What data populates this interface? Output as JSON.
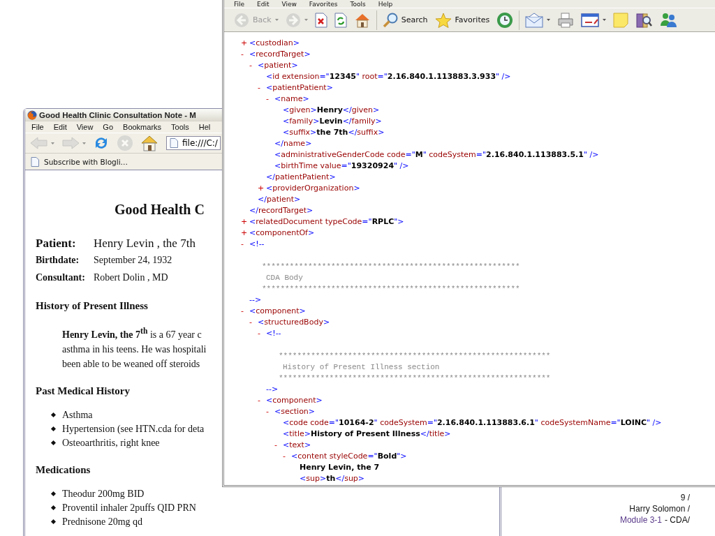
{
  "firefox_window": {
    "title": "Good Health Clinic Consultation Note - M",
    "menu": [
      "File",
      "Edit",
      "View",
      "Go",
      "Bookmarks",
      "Tools",
      "Hel"
    ],
    "toolbar": [
      {
        "kind": "back",
        "disabled": true,
        "dropdown": true
      },
      {
        "kind": "forward",
        "disabled": true,
        "dropdown": true
      },
      {
        "kind": "reload",
        "disabled": false,
        "dropdown": false
      },
      {
        "kind": "stop",
        "disabled": true,
        "dropdown": false
      },
      {
        "kind": "home",
        "disabled": false,
        "dropdown": false
      }
    ],
    "address": "file:///C:/",
    "bookmarks": [
      "Subscribe with Blogli…"
    ],
    "document": {
      "title": "Good Health C",
      "header": [
        {
          "label": "Patient:",
          "value": "Henry Levin , the 7th"
        },
        {
          "label": "Birthdate:",
          "value": "September 24, 1932"
        },
        {
          "label": "Consultant:",
          "value": "Robert Dolin , MD"
        }
      ],
      "sections": [
        {
          "kind": "paragraph",
          "heading": "History of Present Illness",
          "lines": [
            "**Henry Levin, the 7$^{th}$** is a 67 year c",
            "asthma in his teens. He was hospitali",
            "been able to be weaned off steroids"
          ]
        },
        {
          "kind": "list",
          "heading": "Past Medical History",
          "items": [
            "Asthma",
            "Hypertension (see HTN.cda for deta",
            "Osteoarthritis, right knee"
          ]
        },
        {
          "kind": "list",
          "heading": "Medications",
          "items": [
            "Theodur 200mg BID",
            "Proventil inhaler 2puffs QID PRN",
            "Prednisone 20mg qd"
          ]
        }
      ]
    }
  },
  "ie_window": {
    "menu": [
      "File",
      "Edit",
      "View",
      "Favorites",
      "Tools",
      "Help"
    ],
    "toolbar": [
      [
        {
          "kind": "back",
          "label": "Back",
          "disabled": true,
          "dropdown": true
        },
        {
          "kind": "forward",
          "disabled": true,
          "dropdown": true
        },
        {
          "kind": "stop",
          "disabled": false,
          "dropdown": false
        },
        {
          "kind": "refresh",
          "disabled": false,
          "dropdown": false
        },
        {
          "kind": "home",
          "disabled": false,
          "dropdown": false
        }
      ],
      [
        {
          "kind": "search",
          "label": "Search",
          "disabled": false,
          "dropdown": false
        },
        {
          "kind": "favorites",
          "label": "Favorites",
          "disabled": false,
          "dropdown": false
        },
        {
          "kind": "history",
          "disabled": false,
          "dropdown": false
        }
      ],
      [
        {
          "kind": "mail",
          "disabled": false,
          "dropdown": true
        },
        {
          "kind": "print",
          "disabled": false,
          "dropdown": false
        },
        {
          "kind": "edit",
          "disabled": false,
          "dropdown": true
        },
        {
          "kind": "note",
          "disabled": false,
          "dropdown": false
        },
        {
          "kind": "research",
          "disabled": false,
          "dropdown": false
        },
        {
          "kind": "messenger",
          "disabled": false,
          "dropdown": false
        }
      ]
    ],
    "xml": [
      {
        "toggle": "+",
        "line": [
          {
            "kind": "punct",
            "text": "<"
          },
          {
            "kind": "tag",
            "text": "custodian"
          },
          {
            "kind": "punct",
            "text": ">"
          }
        ]
      },
      {
        "toggle": "-",
        "line": [
          {
            "kind": "punct",
            "text": "<"
          },
          {
            "kind": "tag",
            "text": "recordTarget"
          },
          {
            "kind": "punct",
            "text": ">"
          }
        ],
        "children": [
          {
            "toggle": "-",
            "line": [
              {
                "kind": "punct",
                "text": "<"
              },
              {
                "kind": "tag",
                "text": "patient"
              },
              {
                "kind": "punct",
                "text": ">"
              }
            ],
            "children": [
              {
                "line": [
                  {
                    "kind": "punct",
                    "text": "<"
                  },
                  {
                    "kind": "tag",
                    "text": "id "
                  },
                  {
                    "kind": "attr",
                    "text": "extension"
                  },
                  {
                    "kind": "punct",
                    "text": "=\""
                  },
                  {
                    "kind": "value",
                    "text": "12345"
                  },
                  {
                    "kind": "punct",
                    "text": "\" "
                  },
                  {
                    "kind": "attr",
                    "text": "root"
                  },
                  {
                    "kind": "punct",
                    "text": "=\""
                  },
                  {
                    "kind": "value",
                    "text": "2.16.840.1.113883.3.933"
                  },
                  {
                    "kind": "punct",
                    "text": "\" />"
                  }
                ]
              },
              {
                "toggle": "-",
                "line": [
                  {
                    "kind": "punct",
                    "text": "<"
                  },
                  {
                    "kind": "tag",
                    "text": "patientPatient"
                  },
                  {
                    "kind": "punct",
                    "text": ">"
                  }
                ],
                "children": [
                  {
                    "toggle": "-",
                    "line": [
                      {
                        "kind": "punct",
                        "text": "<"
                      },
                      {
                        "kind": "tag",
                        "text": "name"
                      },
                      {
                        "kind": "punct",
                        "text": ">"
                      }
                    ],
                    "children": [
                      {
                        "line": [
                          {
                            "kind": "punct",
                            "text": "<"
                          },
                          {
                            "kind": "tag",
                            "text": "given"
                          },
                          {
                            "kind": "punct",
                            "text": ">"
                          },
                          {
                            "kind": "text",
                            "text": "Henry"
                          },
                          {
                            "kind": "punct",
                            "text": "</"
                          },
                          {
                            "kind": "tag",
                            "text": "given"
                          },
                          {
                            "kind": "punct",
                            "text": ">"
                          }
                        ]
                      },
                      {
                        "line": [
                          {
                            "kind": "punct",
                            "text": "<"
                          },
                          {
                            "kind": "tag",
                            "text": "family"
                          },
                          {
                            "kind": "punct",
                            "text": ">"
                          },
                          {
                            "kind": "text",
                            "text": "Levin"
                          },
                          {
                            "kind": "punct",
                            "text": "</"
                          },
                          {
                            "kind": "tag",
                            "text": "family"
                          },
                          {
                            "kind": "punct",
                            "text": ">"
                          }
                        ]
                      },
                      {
                        "line": [
                          {
                            "kind": "punct",
                            "text": "<"
                          },
                          {
                            "kind": "tag",
                            "text": "suffix"
                          },
                          {
                            "kind": "punct",
                            "text": ">"
                          },
                          {
                            "kind": "text",
                            "text": "the 7th"
                          },
                          {
                            "kind": "punct",
                            "text": "</"
                          },
                          {
                            "kind": "tag",
                            "text": "suffix"
                          },
                          {
                            "kind": "punct",
                            "text": ">"
                          }
                        ]
                      }
                    ],
                    "end": [
                      {
                        "kind": "punct",
                        "text": "</"
                      },
                      {
                        "kind": "tag",
                        "text": "name"
                      },
                      {
                        "kind": "punct",
                        "text": ">"
                      }
                    ]
                  },
                  {
                    "line": [
                      {
                        "kind": "punct",
                        "text": "<"
                      },
                      {
                        "kind": "tag",
                        "text": "administrativeGenderCode "
                      },
                      {
                        "kind": "attr",
                        "text": "code"
                      },
                      {
                        "kind": "punct",
                        "text": "=\""
                      },
                      {
                        "kind": "value",
                        "text": "M"
                      },
                      {
                        "kind": "punct",
                        "text": "\" "
                      },
                      {
                        "kind": "attr",
                        "text": "codeSystem"
                      },
                      {
                        "kind": "punct",
                        "text": "=\""
                      },
                      {
                        "kind": "value",
                        "text": "2.16.840.1.113883.5.1"
                      },
                      {
                        "kind": "punct",
                        "text": "\" />"
                      }
                    ]
                  },
                  {
                    "line": [
                      {
                        "kind": "punct",
                        "text": "<"
                      },
                      {
                        "kind": "tag",
                        "text": "birthTime "
                      },
                      {
                        "kind": "attr",
                        "text": "value"
                      },
                      {
                        "kind": "punct",
                        "text": "=\""
                      },
                      {
                        "kind": "value",
                        "text": "19320924"
                      },
                      {
                        "kind": "punct",
                        "text": "\" />"
                      }
                    ]
                  }
                ],
                "end": [
                  {
                    "kind": "punct",
                    "text": "</"
                  },
                  {
                    "kind": "tag",
                    "text": "patientPatient"
                  },
                  {
                    "kind": "punct",
                    "text": ">"
                  }
                ]
              },
              {
                "toggle": "+",
                "line": [
                  {
                    "kind": "punct",
                    "text": "<"
                  },
                  {
                    "kind": "tag",
                    "text": "providerOrganization"
                  },
                  {
                    "kind": "punct",
                    "text": ">"
                  }
                ]
              }
            ],
            "end": [
              {
                "kind": "punct",
                "text": "</"
              },
              {
                "kind": "tag",
                "text": "patient"
              },
              {
                "kind": "punct",
                "text": ">"
              }
            ]
          }
        ],
        "end": [
          {
            "kind": "punct",
            "text": "</"
          },
          {
            "kind": "tag",
            "text": "recordTarget"
          },
          {
            "kind": "punct",
            "text": ">"
          }
        ]
      },
      {
        "toggle": "+",
        "line": [
          {
            "kind": "punct",
            "text": "<"
          },
          {
            "kind": "tag",
            "text": "relatedDocument "
          },
          {
            "kind": "attr",
            "text": "typeCode"
          },
          {
            "kind": "punct",
            "text": "=\""
          },
          {
            "kind": "value",
            "text": "RPLC"
          },
          {
            "kind": "punct",
            "text": "\">"
          }
        ]
      },
      {
        "toggle": "+",
        "line": [
          {
            "kind": "punct",
            "text": "<"
          },
          {
            "kind": "tag",
            "text": "componentOf"
          },
          {
            "kind": "punct",
            "text": ">"
          }
        ]
      },
      {
        "toggle": "-",
        "line": [
          {
            "kind": "punct",
            "text": "<!--"
          }
        ],
        "comment": [
          {
            "kind": "rule",
            "text": "********************************************************"
          },
          {
            "kind": "caption",
            "text": "CDA Body"
          },
          {
            "kind": "rule",
            "text": "********************************************************"
          }
        ],
        "end": [
          {
            "kind": "punct",
            "text": "-->"
          }
        ]
      },
      {
        "toggle": "-",
        "line": [
          {
            "kind": "punct",
            "text": "<"
          },
          {
            "kind": "tag",
            "text": "component"
          },
          {
            "kind": "punct",
            "text": ">"
          }
        ],
        "children": [
          {
            "toggle": "-",
            "line": [
              {
                "kind": "punct",
                "text": "<"
              },
              {
                "kind": "tag",
                "text": "structuredBody"
              },
              {
                "kind": "punct",
                "text": ">"
              }
            ],
            "children": [
              {
                "toggle": "-",
                "line": [
                  {
                    "kind": "punct",
                    "text": "<!--"
                  }
                ],
                "comment": [
                  {
                    "kind": "rule",
                    "text": "***********************************************************"
                  },
                  {
                    "kind": "caption",
                    "text": "History of Present Illness section"
                  },
                  {
                    "kind": "rule",
                    "text": "***********************************************************"
                  }
                ],
                "end": [
                  {
                    "kind": "punct",
                    "text": "-->"
                  }
                ]
              },
              {
                "toggle": "-",
                "line": [
                  {
                    "kind": "punct",
                    "text": "<"
                  },
                  {
                    "kind": "tag",
                    "text": "component"
                  },
                  {
                    "kind": "punct",
                    "text": ">"
                  }
                ],
                "children": [
                  {
                    "toggle": "-",
                    "line": [
                      {
                        "kind": "punct",
                        "text": "<"
                      },
                      {
                        "kind": "tag",
                        "text": "section"
                      },
                      {
                        "kind": "punct",
                        "text": ">"
                      }
                    ],
                    "children": [
                      {
                        "line": [
                          {
                            "kind": "punct",
                            "text": "<"
                          },
                          {
                            "kind": "tag",
                            "text": "code "
                          },
                          {
                            "kind": "attr",
                            "text": "code"
                          },
                          {
                            "kind": "punct",
                            "text": "=\""
                          },
                          {
                            "kind": "value",
                            "text": "10164-2"
                          },
                          {
                            "kind": "punct",
                            "text": "\" "
                          },
                          {
                            "kind": "attr",
                            "text": "codeSystem"
                          },
                          {
                            "kind": "punct",
                            "text": "=\""
                          },
                          {
                            "kind": "value",
                            "text": "2.16.840.1.113883.6.1"
                          },
                          {
                            "kind": "punct",
                            "text": "\" "
                          },
                          {
                            "kind": "attr",
                            "text": "codeSystemName"
                          },
                          {
                            "kind": "punct",
                            "text": "=\""
                          },
                          {
                            "kind": "value",
                            "text": "LOINC"
                          },
                          {
                            "kind": "punct",
                            "text": "\" />"
                          }
                        ]
                      },
                      {
                        "line": [
                          {
                            "kind": "punct",
                            "text": "<"
                          },
                          {
                            "kind": "tag",
                            "text": "title"
                          },
                          {
                            "kind": "punct",
                            "text": ">"
                          },
                          {
                            "kind": "text",
                            "text": "History of Present Illness"
                          },
                          {
                            "kind": "punct",
                            "text": "</"
                          },
                          {
                            "kind": "tag",
                            "text": "title"
                          },
                          {
                            "kind": "punct",
                            "text": ">"
                          }
                        ]
                      },
                      {
                        "toggle": "-",
                        "line": [
                          {
                            "kind": "punct",
                            "text": "<"
                          },
                          {
                            "kind": "tag",
                            "text": "text"
                          },
                          {
                            "kind": "punct",
                            "text": ">"
                          }
                        ],
                        "children": [
                          {
                            "toggle": "-",
                            "line": [
                              {
                                "kind": "punct",
                                "text": "<"
                              },
                              {
                                "kind": "tag",
                                "text": "content "
                              },
                              {
                                "kind": "attr",
                                "text": "styleCode"
                              },
                              {
                                "kind": "punct",
                                "text": "=\""
                              },
                              {
                                "kind": "value",
                                "text": "Bold"
                              },
                              {
                                "kind": "punct",
                                "text": "\">"
                              }
                            ],
                            "children": [
                              {
                                "line": [
                                  {
                                    "kind": "text",
                                    "text": "Henry Levin, the 7"
                                  }
                                ]
                              },
                              {
                                "line": [
                                  {
                                    "kind": "punct",
                                    "text": "<"
                                  },
                                  {
                                    "kind": "tag",
                                    "text": "sup"
                                  },
                                  {
                                    "kind": "punct",
                                    "text": ">"
                                  },
                                  {
                                    "kind": "text",
                                    "text": "th"
                                  },
                                  {
                                    "kind": "punct",
                                    "text": "</"
                                  },
                                  {
                                    "kind": "tag",
                                    "text": "sup"
                                  },
                                  {
                                    "kind": "punct",
                                    "text": ">"
                                  }
                                ]
                              }
                            ]
                          }
                        ]
                      }
                    ]
                  }
                ]
              }
            ]
          }
        ]
      }
    ]
  },
  "slide_footer": {
    "page": "9 /",
    "author": "Harry Solomon /",
    "module": "Module 3-1",
    "course": "- CDA/"
  }
}
